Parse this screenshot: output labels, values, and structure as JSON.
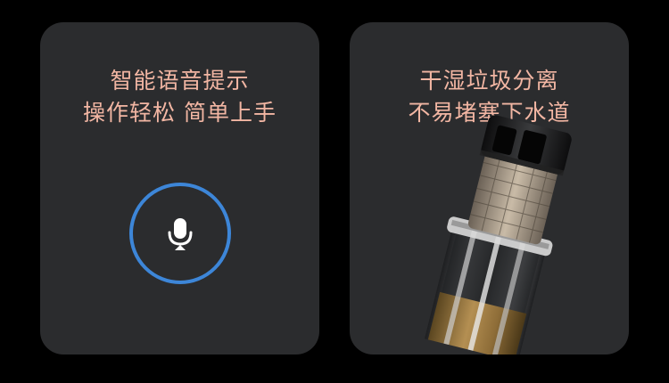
{
  "left_card": {
    "title_line1": "智能语音提示",
    "title_line2": "操作轻松 简单上手",
    "icon": "microphone-icon",
    "ring_color": "#3d86d8"
  },
  "right_card": {
    "title_line1": "干湿垃圾分离",
    "title_line2": "不易堵塞下水道",
    "image": "drain-filter-product"
  },
  "colors": {
    "background": "#000000",
    "card": "#2b2c2e",
    "headline": "#f2b6a3"
  }
}
